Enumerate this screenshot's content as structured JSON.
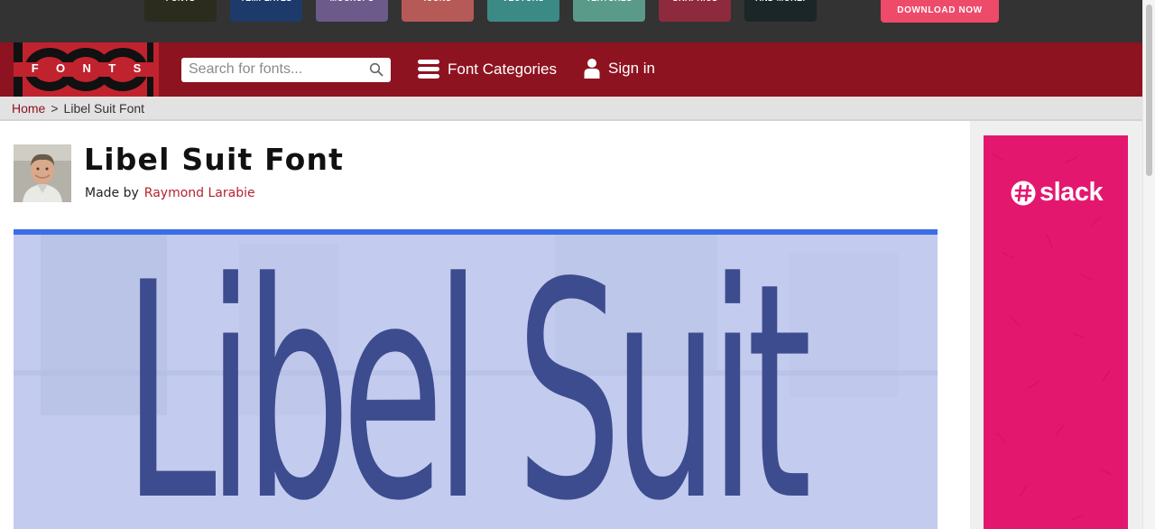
{
  "ad_strip": {
    "tiles": [
      {
        "label": "FONTS",
        "color": "#2b2b1e"
      },
      {
        "label": "TEMPLATES",
        "color": "#1d3a6b"
      },
      {
        "label": "MOCKUPS",
        "color": "#6b5a8a"
      },
      {
        "label": "ICONS",
        "color": "#b65a57"
      },
      {
        "label": "VECTORS",
        "color": "#3c8a86"
      },
      {
        "label": "TEXTURES",
        "color": "#5a9a88"
      },
      {
        "label": "GRAPHICS",
        "color": "#8e2a3e"
      },
      {
        "label": "AND MORE!",
        "color": "#1a2628"
      }
    ],
    "download_label": "DOWNLOAD NOW"
  },
  "nav": {
    "logo_letters": [
      "F",
      "O",
      "N",
      "T",
      "S"
    ],
    "search_placeholder": "Search for fonts...",
    "font_categories_label": "Font Categories",
    "signin_label": "Sign in"
  },
  "breadcrumb": {
    "home": "Home",
    "separator": ">",
    "current": "Libel Suit Font"
  },
  "font": {
    "title": "Libel Suit Font",
    "made_by_label": "Made by",
    "author": "Raymond Larabie",
    "preview_text": "Libel Suit"
  },
  "side_ad": {
    "brand": "slack"
  },
  "colors": {
    "nav_red": "#8e1320",
    "accent_link": "#b5222e",
    "preview_border": "#3b6ee8",
    "slack_pink": "#e4176e"
  }
}
